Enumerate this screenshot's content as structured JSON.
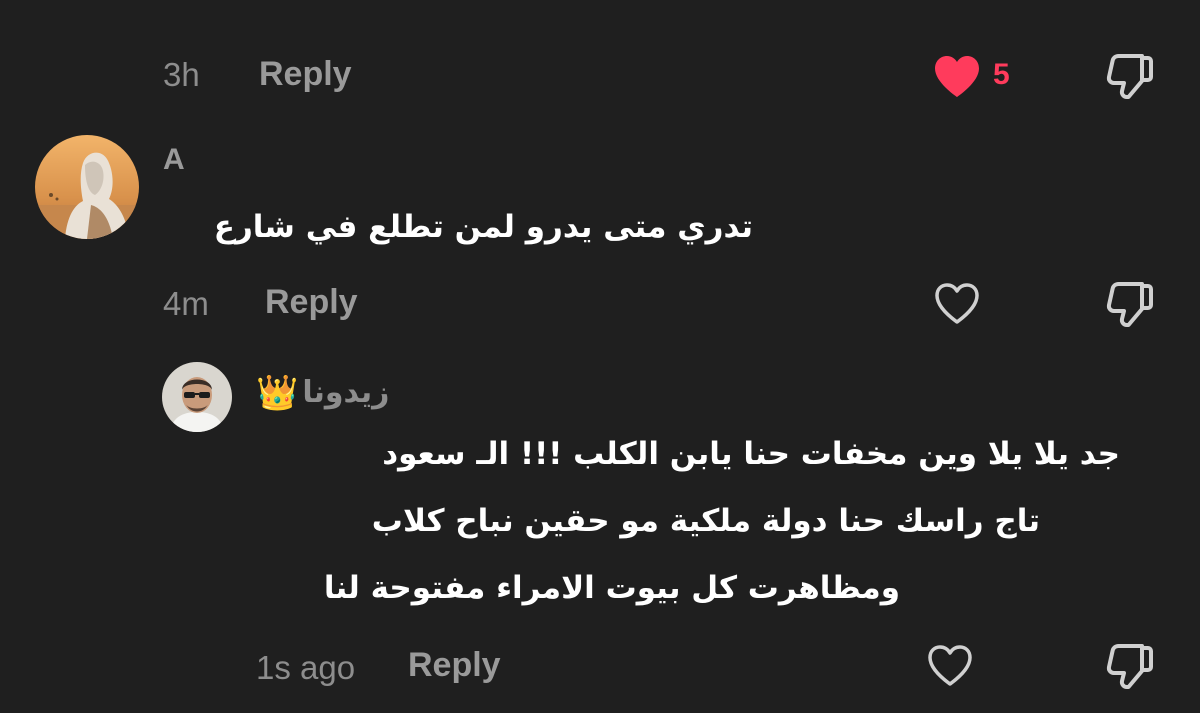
{
  "top_row": {
    "timestamp": "3h",
    "reply_label": "Reply",
    "like_count": "5",
    "liked": true
  },
  "comments": [
    {
      "username": "A",
      "text": "تدري متى يدرو لمن تطلع في شارع",
      "timestamp": "4m",
      "reply_label": "Reply",
      "liked": false
    },
    {
      "username": "زيدونا",
      "username_emoji": "👑",
      "text_lines": [
        "جد يلا يلا وين مخفات حنا يابن الكلب !!! الـ سعود",
        "تاج راسك حنا دولة ملكية مو حقين نباح كلاب",
        "ومظاهرت كل بيوت الامراء مفتوحة لنا"
      ],
      "timestamp": "1s ago",
      "reply_label": "Reply",
      "liked": false
    }
  ],
  "colors": {
    "background": "#1f1f1f",
    "like_active": "#ff3b5c",
    "muted_text": "#8d8d8d",
    "reply_text": "#9a9a9a",
    "body_text": "#ffffff"
  },
  "icons": {
    "like": "heart-icon",
    "dislike": "thumbs-down-icon",
    "crown": "crown-emoji"
  }
}
